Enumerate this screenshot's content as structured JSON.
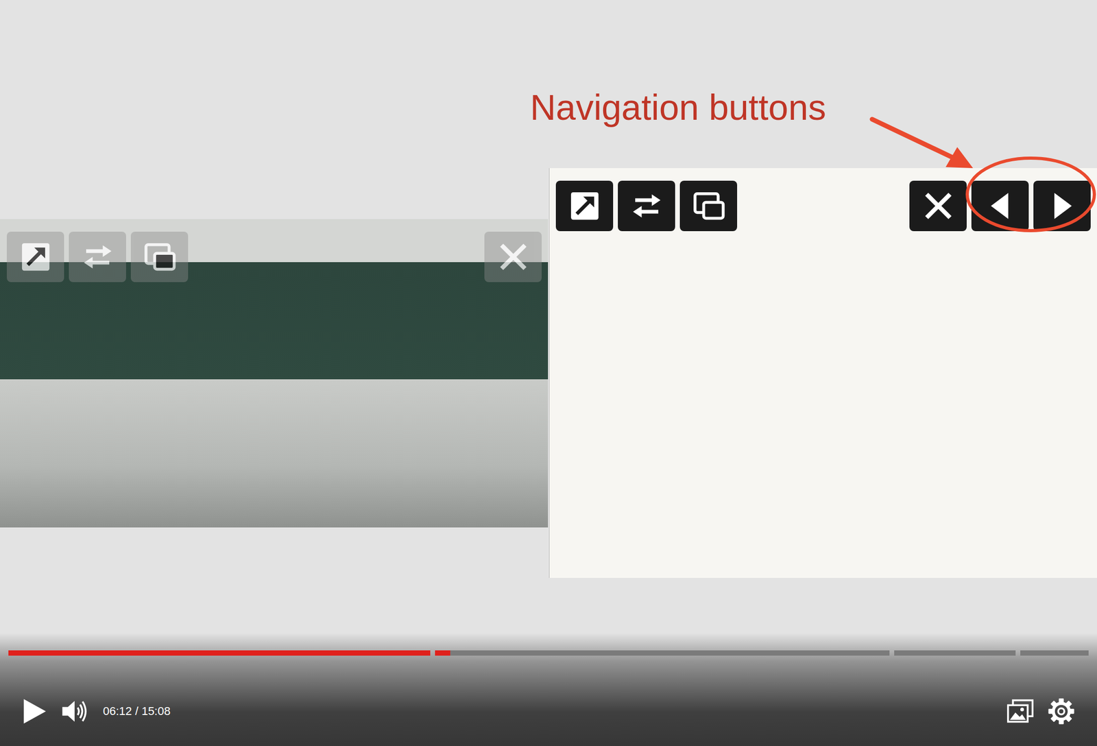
{
  "annotation": {
    "label": "Navigation buttons"
  },
  "panels": [
    {
      "kind": "camera",
      "focused": false,
      "buttons": [
        {
          "kind": "expand"
        },
        {
          "kind": "swap"
        },
        {
          "kind": "pip"
        },
        {
          "kind": "close"
        }
      ]
    },
    {
      "kind": "slides",
      "focused": true,
      "buttons": [
        {
          "kind": "expand"
        },
        {
          "kind": "swap"
        },
        {
          "kind": "pip"
        },
        {
          "kind": "close"
        },
        {
          "kind": "prev"
        },
        {
          "kind": "next"
        }
      ]
    }
  ],
  "player": {
    "playing": false,
    "time": "06:12 / 15:08",
    "progress": {
      "level": 0.41
    },
    "chapters": [
      {
        "end": 0.396
      },
      {
        "end": 0.822
      },
      {
        "end": 0.936
      },
      {
        "end": 1
      }
    ]
  }
}
